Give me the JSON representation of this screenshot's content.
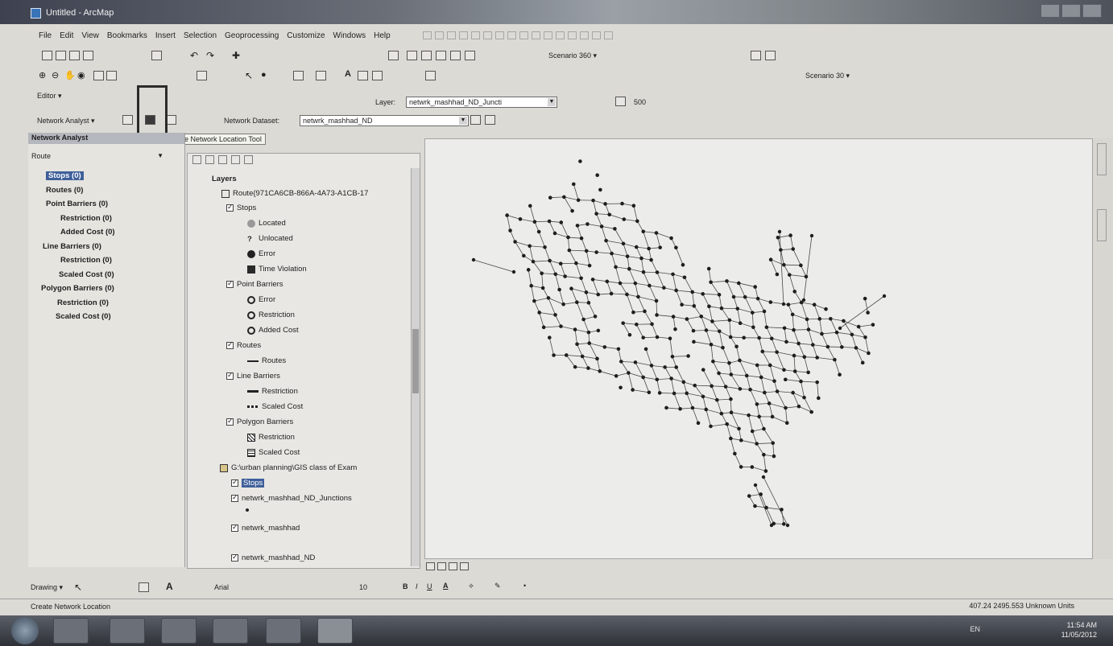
{
  "window": {
    "title": "Untitled - ArcMap"
  },
  "menu": [
    "File",
    "Edit",
    "View",
    "Bookmarks",
    "Insert",
    "Selection",
    "Geoprocessing",
    "Customize",
    "Windows",
    "Help"
  ],
  "toolbars": {
    "editor_label": "Editor ▾",
    "scenario_label_1": "Scenario 360 ▾",
    "scenario_label_2": "Scenario 30 ▾",
    "layer_label": "Layer:",
    "layer_value": "netwrk_mashhad_ND_Juncti",
    "scale_value": "500",
    "network_analyst_label": "Network Analyst ▾",
    "network_dataset_label": "Network Dataset:",
    "network_dataset_value": "netwrk_mashhad_ND"
  },
  "tooltip": "Create Network Location Tool",
  "na_window": {
    "title": "Network Analyst",
    "analysis_layer": "Route",
    "tree": [
      {
        "label": "Stops (0)",
        "selected": true
      },
      {
        "label": "Routes (0)"
      },
      {
        "label": "Point Barriers (0)"
      },
      {
        "label": "Restriction (0)"
      },
      {
        "label": "Added Cost (0)"
      },
      {
        "label": "Line Barriers (0)"
      },
      {
        "label": "Restriction (0)"
      },
      {
        "label": "Scaled Cost (0)"
      },
      {
        "label": "Polygon Barriers (0)"
      },
      {
        "label": "Restriction (0)"
      },
      {
        "label": "Scaled Cost (0)"
      }
    ]
  },
  "toc": {
    "root": "Layers",
    "route_group": "Route{971CA6CB-866A-4A73-A1CB-17",
    "stops": "Stops",
    "located": "Located",
    "unlocated": "Unlocated",
    "error": "Error",
    "time_violation": "Time Violation",
    "point_barriers": "Point Barriers",
    "pb_error": "Error",
    "pb_restriction": "Restriction",
    "pb_added_cost": "Added Cost",
    "routes": "Routes",
    "routes_sym": "Routes",
    "line_barriers": "Line Barriers",
    "lb_restriction": "Restriction",
    "lb_scaled_cost": "Scaled Cost",
    "polygon_barriers": "Polygon Barriers",
    "pg_restriction": "Restriction",
    "pg_scaled_cost": "Scaled Cost",
    "gdb_path": "G:\\urban planning\\GIS class of Exam",
    "stops_layer": "Stops",
    "junctions_layer": "netwrk_mashhad_ND_Junctions",
    "network_layer": "netwrk_mashhad",
    "nd_layer": "netwrk_mashhad_ND"
  },
  "drawing": {
    "label": "Drawing ▾",
    "font": "Arial",
    "font_size": "10"
  },
  "status": {
    "message": "Create Network Location",
    "coords": "407.24  2495.553 Unknown Units"
  },
  "taskbar": {
    "lang": "EN",
    "time": "11:54 AM",
    "date": "11/05/2012"
  },
  "colors": {
    "map_bg": "#ececea",
    "node": "#1e1e1e",
    "edge": "#4a4a4a"
  }
}
